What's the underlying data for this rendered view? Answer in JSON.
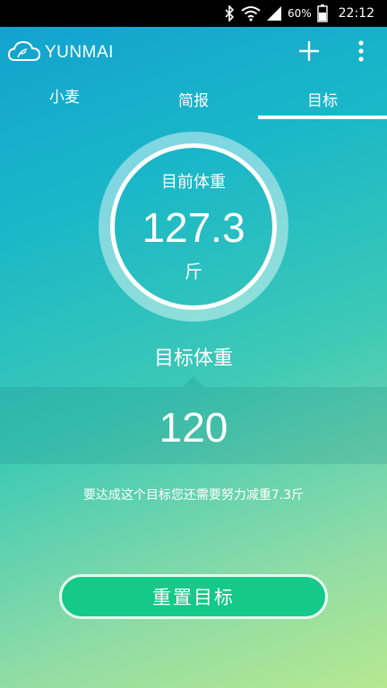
{
  "status_bar": {
    "battery_percent": "60%",
    "time": "22:12",
    "icons": [
      "bluetooth-icon",
      "wifi-icon",
      "signal-icon",
      "battery-icon"
    ]
  },
  "app_bar": {
    "logo_text": "YUNMAI",
    "icons": [
      "cloud-logo-icon",
      "plus-icon",
      "overflow-menu-icon"
    ]
  },
  "tabs": [
    {
      "label": "小麦"
    },
    {
      "label": "简报"
    },
    {
      "label": "目标",
      "selected": true
    }
  ],
  "current_weight": {
    "label": "目前体重",
    "value": "127.3",
    "unit": "斤"
  },
  "target": {
    "label": "目标体重",
    "value": "120"
  },
  "hint": "要达成这个目标您还需要努力减重7.3斤",
  "reset_button": "重置目标",
  "colors": {
    "gradient_top": "#129fd0",
    "gradient_bottom": "#b6e88f",
    "button_green": "#14c98a"
  }
}
